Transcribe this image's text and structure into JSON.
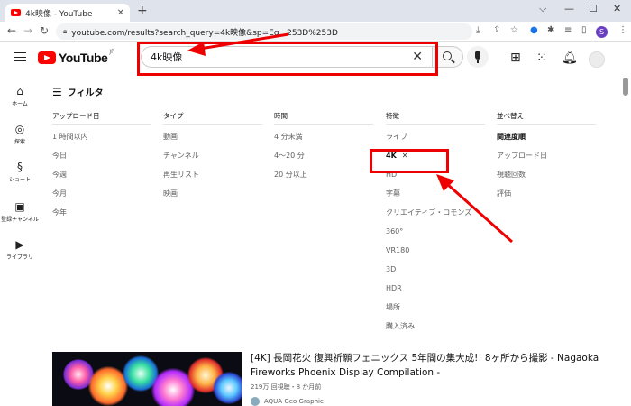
{
  "browser": {
    "tab_title": "4k映像 - YouTube",
    "new_tab": "+",
    "window_controls": [
      "⌵",
      "—",
      "☐",
      "✕"
    ],
    "url": "youtube.com/results?search_query=4k映像&sp=Eg...253D%253D"
  },
  "youtube": {
    "logo_text": "YouTube",
    "region": "JP",
    "search_query": "4k映像"
  },
  "guide": [
    {
      "label": "ホーム",
      "icon": "home-icon"
    },
    {
      "label": "探索",
      "icon": "compass-icon"
    },
    {
      "label": "ショート",
      "icon": "shorts-icon"
    },
    {
      "label": "登録チャンネル",
      "icon": "subscriptions-icon"
    },
    {
      "label": "ライブラリ",
      "icon": "library-icon"
    }
  ],
  "filters": {
    "title": "フィルタ",
    "columns": [
      {
        "header": "アップロード日",
        "items": [
          "1 時間以内",
          "今日",
          "今週",
          "今月",
          "今年"
        ]
      },
      {
        "header": "タイプ",
        "items": [
          "動画",
          "チャンネル",
          "再生リスト",
          "映画"
        ]
      },
      {
        "header": "時間",
        "items": [
          "4 分未満",
          "4〜20 分",
          "20 分以上"
        ]
      },
      {
        "header": "特徴",
        "items": [
          "ライブ",
          "4K",
          "HD",
          "字幕",
          "クリエイティブ・コモンズ",
          "360°",
          "VR180",
          "3D",
          "HDR",
          "場所",
          "購入済み"
        ],
        "active_index": 1
      },
      {
        "header": "並べ替え",
        "items": [
          "関連度順",
          "アップロード日",
          "視聴回数",
          "評価"
        ],
        "active_index": 0
      }
    ]
  },
  "result": {
    "title": "[4K] 長岡花火 復興祈願フェニックス 5年間の集大成!! 8ヶ所から撮影 - Nagaoka Fireworks Phoenix Display Compilation -",
    "meta": "219万 回視聴・8 か月前",
    "channel": "AQUA Geo Graphic"
  },
  "colors": {
    "annotation": "#e00000",
    "brand": "#ff0000",
    "active_filter": "#0f0f0f",
    "inactive_filter": "#606060"
  }
}
